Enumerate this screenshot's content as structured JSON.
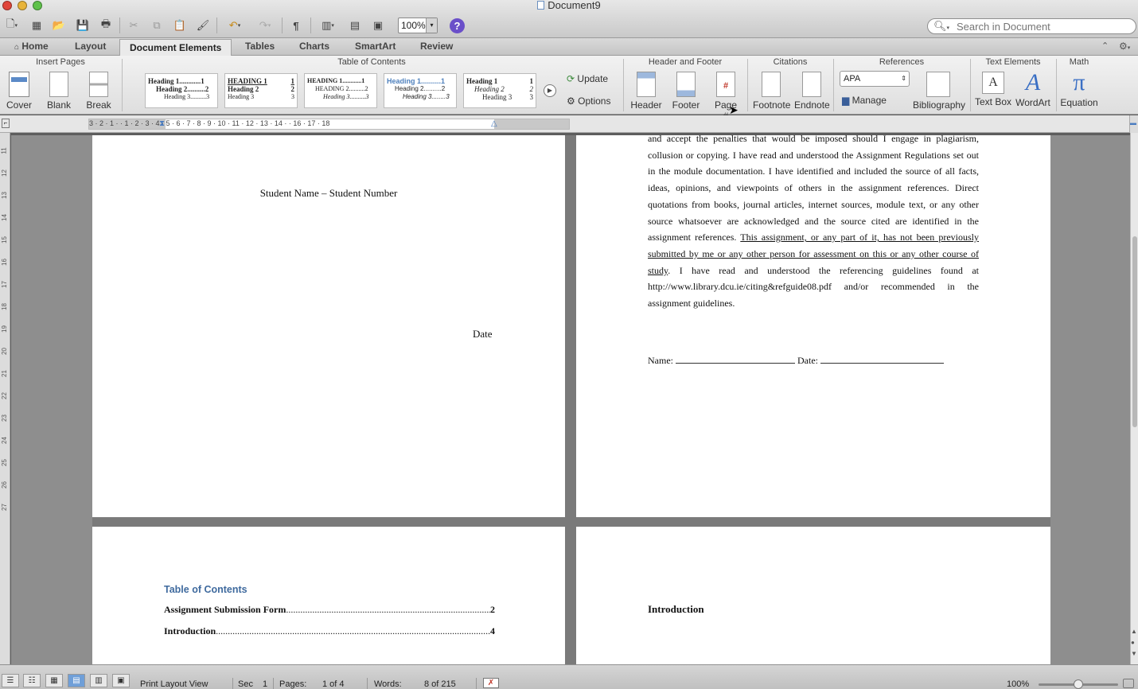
{
  "window": {
    "title": "Document9"
  },
  "toolbar": {
    "zoom": "100%",
    "search_placeholder": "Search in Document"
  },
  "tabs": [
    {
      "label": "Home"
    },
    {
      "label": "Layout"
    },
    {
      "label": "Document Elements"
    },
    {
      "label": "Tables"
    },
    {
      "label": "Charts"
    },
    {
      "label": "SmartArt"
    },
    {
      "label": "Review"
    }
  ],
  "ribbon": {
    "groups": {
      "insert_pages": "Insert Pages",
      "toc": "Table of Contents",
      "header_footer": "Header and Footer",
      "citations": "Citations",
      "references": "References",
      "text_elements": "Text Elements",
      "math": "Math"
    },
    "insert_pages": {
      "cover": "Cover",
      "blank": "Blank",
      "break": "Break"
    },
    "toc_styles": [
      {
        "h1": "Heading 1............1",
        "h2": "Heading 2..........2",
        "h3": "Heading 3..........3"
      },
      {
        "h1": "HEADING 1",
        "n1": "1",
        "h2": "Heading 2",
        "n2": "2",
        "h3": "Heading 3",
        "n3": "3"
      },
      {
        "h1": "HEADING 1............1",
        "h2": "HEADING 2..........2",
        "h3": "Heading 3..........3"
      },
      {
        "h1": "Heading 1..........1",
        "h2": "Heading 2..........2",
        "h3": "Heading 3........3"
      },
      {
        "h1": "Heading 1",
        "n1": "1",
        "h2": "Heading 2",
        "n2": "2",
        "h3": "Heading 3",
        "n3": "3"
      }
    ],
    "update": "Update",
    "options": "Options",
    "header": "Header",
    "footer": "Footer",
    "page_num": "Page #",
    "footnote": "Footnote",
    "endnote": "Endnote",
    "style_select": "APA",
    "manage": "Manage",
    "bibliography": "Bibliography",
    "textbox": "Text Box",
    "wordart": "WordArt",
    "equation": "Equation"
  },
  "ruler": {
    "h_ticks": "3 · 2 · 1 · · 1 · 2 · 3 · 4 · 5 · 6 · 7 · 8 · 9 · 10 · 11 · 12 · 13 · 14 · · 16 · 17 · 18",
    "v_ticks": [
      "11",
      "12",
      "13",
      "14",
      "15",
      "16",
      "17",
      "18",
      "19",
      "20",
      "21",
      "22",
      "23",
      "24",
      "25",
      "26",
      "27"
    ]
  },
  "pages": {
    "title_page": {
      "student_line": "Student Name – Student Number",
      "date": "Date"
    },
    "declaration": {
      "p1": "and accept the penalties that would be imposed should I engage in plagiarism, collusion or copying.  I have read and understood the Assignment Regulations set out in the module documentation.  I have identified and included the source of all facts, ideas, opinions, and viewpoints of others in the assignment references.  Direct quotations from books, journal articles, internet sources, module text, or any other source whatsoever are acknowledged and the source cited are identified in the assignment references.  ",
      "p1_underlined": "This assignment, or any part of it, has not been previously submitted by me or any other person for assessment on this or any other course of study",
      "p1_tail": ".  I have read and understood the referencing guidelines found at http://www.library.dcu.ie/citing&refguide08.pdf and/or recommended in the assignment guidelines.",
      "name_label": "Name:",
      "date_label": "Date:"
    },
    "toc_page": {
      "heading": "Table of Contents",
      "entries": [
        {
          "title": "Assignment Submission Form",
          "page": "2"
        },
        {
          "title": "Introduction",
          "page": "4"
        }
      ]
    },
    "intro_page": {
      "heading": "Introduction"
    }
  },
  "status": {
    "view": "Print Layout View",
    "sec_label": "Sec",
    "sec": "1",
    "pages_label": "Pages:",
    "pages": "1 of 4",
    "words_label": "Words:",
    "words": "8 of 215",
    "zoom": "100%"
  }
}
